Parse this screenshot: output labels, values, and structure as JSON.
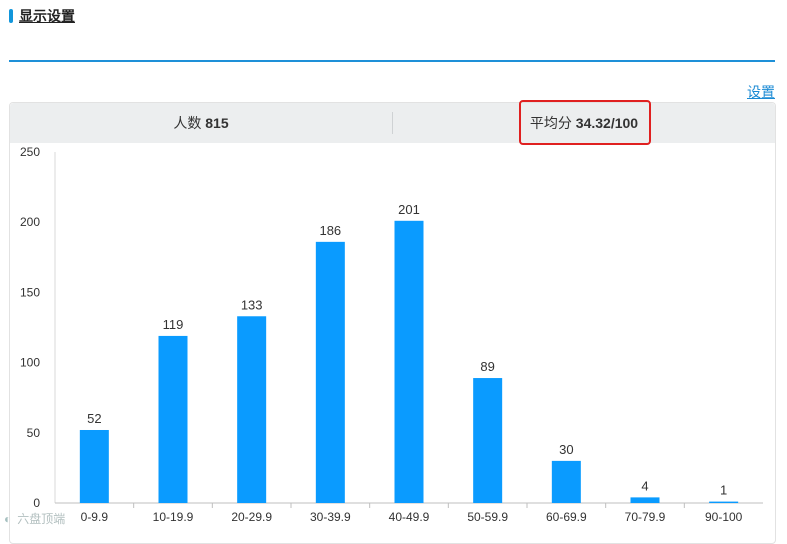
{
  "section": {
    "title": "显示设置"
  },
  "settings_link": "设置",
  "stats": {
    "count_label": "人数",
    "count_value": "815",
    "avg_label": "平均分",
    "avg_value": "34.32/100"
  },
  "colors": {
    "bar": "#0a9bff",
    "accent": "#1e90d8",
    "highlight": "#e02020"
  },
  "watermark": {
    "text": "六盘顶端",
    "logo": "◐"
  },
  "chart_data": {
    "type": "bar",
    "categories": [
      "0-9.9",
      "10-19.9",
      "20-29.9",
      "30-39.9",
      "40-49.9",
      "50-59.9",
      "60-69.9",
      "70-79.9",
      "90-100"
    ],
    "values": [
      52,
      119,
      133,
      186,
      201,
      89,
      30,
      4,
      1
    ],
    "title": "",
    "xlabel": "",
    "ylabel": "",
    "ylim": [
      0,
      250
    ],
    "yticks": [
      0,
      50,
      100,
      150,
      200,
      250
    ],
    "grid": false,
    "legend": "none"
  }
}
